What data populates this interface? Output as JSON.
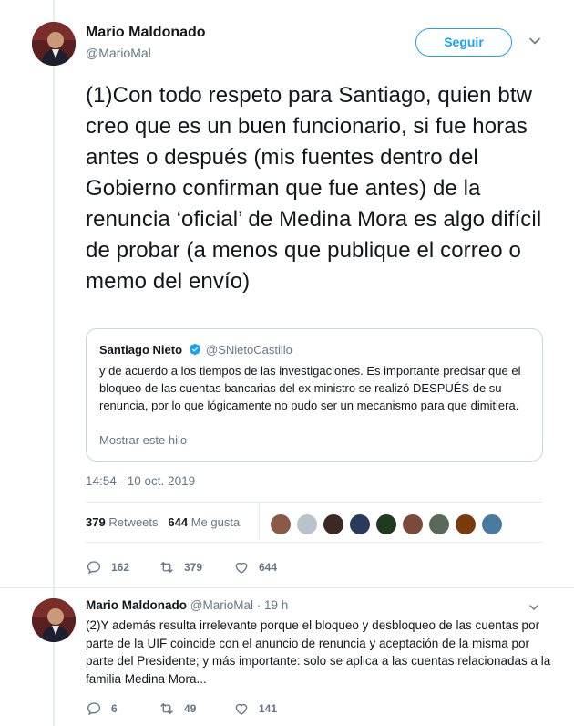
{
  "main_tweet": {
    "author": {
      "name": "Mario Maldonado",
      "handle": "@MarioMal"
    },
    "follow_label": "Seguir",
    "text": "(1)Con todo respeto para Santiago, quien btw creo que es un buen funcionario, si fue horas antes o después (mis fuentes dentro del Gobierno confirman que fue antes) de la renuncia ‘oficial’ de Medina Mora es algo difícil de probar (a menos que publique el correo o memo del envío)",
    "quoted": {
      "name": "Santiago Nieto",
      "handle": "@SNietoCastillo",
      "text": "y de acuerdo a los tiempos de las investigaciones. Es importante precisar que el bloqueo de las cuentas bancarias del ex ministro se realizó DESPUÉS de su renuncia, por lo que lógicamente no pudo ser un mecanismo para que dimitiera.",
      "show_thread": "Mostrar este hilo"
    },
    "timestamp": "14:54 - 10 oct. 2019",
    "stats": {
      "retweets_count": "379",
      "retweets_label": "Retweets",
      "likes_count": "644",
      "likes_label": "Me gusta"
    },
    "actions": {
      "replies": "162",
      "retweets": "379",
      "likes": "644"
    },
    "liker_colors": [
      "#8a5a48",
      "#b9c3cc",
      "#3b2a24",
      "#2a3a5a",
      "#1f3a1f",
      "#7a4a3a",
      "#5a6a5a",
      "#7a3a10",
      "#4a7aa0"
    ]
  },
  "reply_tweet": {
    "author": {
      "name": "Mario Maldonado",
      "handle": "@MarioMal"
    },
    "time": "· 19 h",
    "text": "(2)Y además resulta irrelevante porque el bloqueo y desbloqueo de las cuentas por parte de la UIF coincide con el anuncio de renuncia y aceptación de la misma por parte del Presidente; y más importante: solo se aplica a las cuentas relacionadas a la familia Medina Mora...",
    "actions": {
      "replies": "6",
      "retweets": "49",
      "likes": "141"
    }
  },
  "colors": {
    "accent": "#1da1f2",
    "secondary_text": "#657786",
    "border": "#e6ecf0",
    "verified": "#1da1f2"
  }
}
